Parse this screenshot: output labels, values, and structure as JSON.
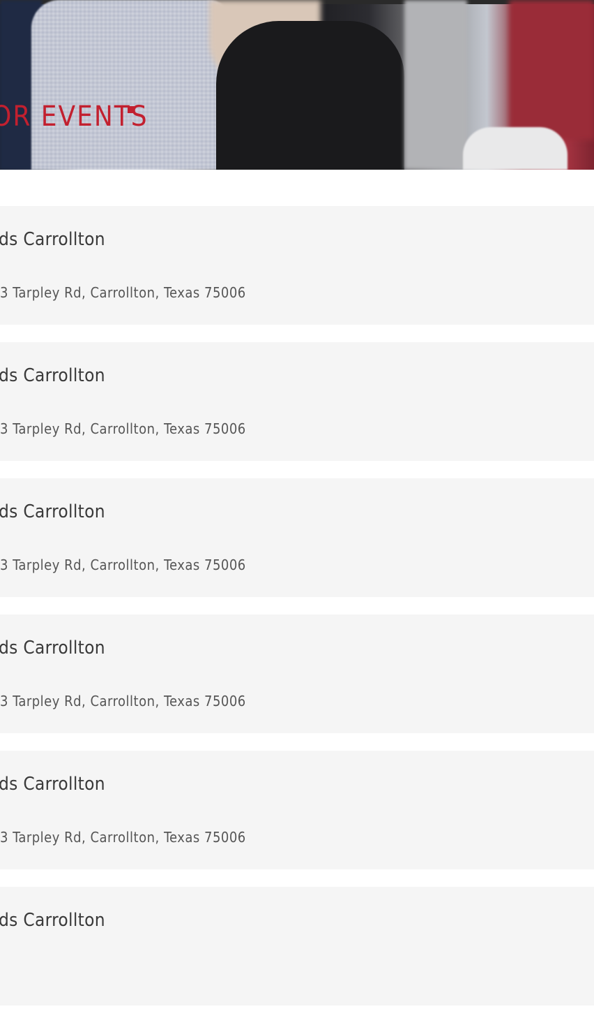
{
  "hero": {
    "title": "OR EVENTS"
  },
  "events": [
    {
      "name": "ds Carrollton",
      "address": "3 Tarpley Rd, Carrollton, Texas 75006"
    },
    {
      "name": "ds Carrollton",
      "address": "3 Tarpley Rd, Carrollton, Texas 75006"
    },
    {
      "name": "ds Carrollton",
      "address": "3 Tarpley Rd, Carrollton, Texas 75006"
    },
    {
      "name": "ds Carrollton",
      "address": "3 Tarpley Rd, Carrollton, Texas 75006"
    },
    {
      "name": "ds Carrollton",
      "address": "3 Tarpley Rd, Carrollton, Texas 75006"
    },
    {
      "name": "ds Carrollton",
      "address": ""
    }
  ],
  "colors": {
    "accent": "#c2202f",
    "card_background": "#f5f5f5",
    "title_text": "#3a3a3a",
    "address_text": "#555555"
  }
}
